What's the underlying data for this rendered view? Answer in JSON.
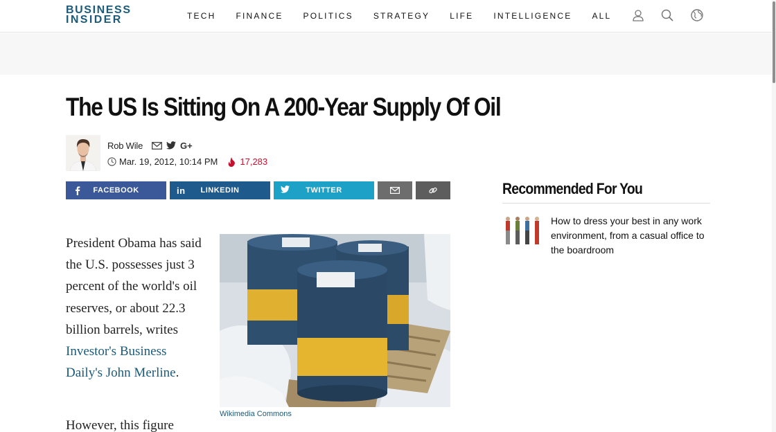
{
  "header": {
    "logo_line1": "BUSINESS",
    "logo_line2": "INSIDER",
    "nav": [
      "TECH",
      "FINANCE",
      "POLITICS",
      "STRATEGY",
      "LIFE",
      "INTELLIGENCE",
      "ALL"
    ],
    "icons": [
      "user-icon",
      "search-icon",
      "globe-icon"
    ]
  },
  "article": {
    "headline": "The US Is Sitting On A 200-Year Supply Of Oil",
    "author": "Rob Wile",
    "date": "Mar. 19, 2012, 10:14 PM",
    "views": "17,283",
    "share": {
      "facebook": "FACEBOOK",
      "linkedin": "LINKEDIN",
      "twitter": "TWITTER"
    },
    "para1_text": "President Obama has said the U.S. possesses just 3 percent of the world's oil reserves, or about 22.3 billion barrels, writes ",
    "para1_link": "Investor's Business Daily's John Merline",
    "para1_end": ".",
    "para2_start": "However, this figure",
    "image_caption": "Wikimedia Commons"
  },
  "sidebar": {
    "title": "Recommended For You",
    "items": [
      {
        "text": "How to dress your best in any work environment, from a casual office to the boardroom"
      }
    ]
  },
  "colors": {
    "brand": "#1b5a7a",
    "facebook": "#3b5998",
    "linkedin": "#1f5a8c",
    "twitter": "#1da1c7",
    "email": "#6d6d6d",
    "link": "#5d5d5d",
    "views": "#c8102e"
  }
}
